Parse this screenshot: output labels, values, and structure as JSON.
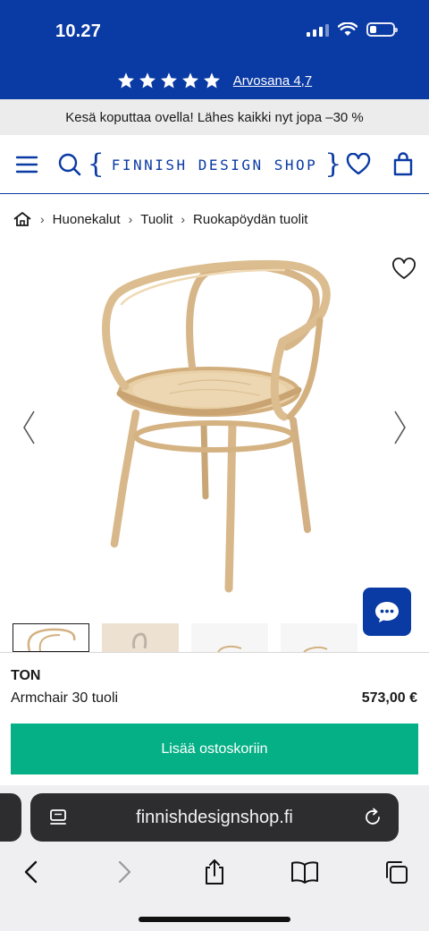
{
  "status_bar": {
    "time": "10.27",
    "battery_level": 0.3
  },
  "rating": {
    "stars": 5,
    "label": "Arvosana 4,7"
  },
  "promo": {
    "text": "Kesä koputtaa ovella! Lähes kaikki nyt jopa –30 %"
  },
  "header": {
    "logo_text": "FINNISH DESIGN SHOP",
    "icons": [
      "menu-icon",
      "search-icon",
      "heart-icon",
      "bag-icon"
    ],
    "accent_color": "#0a3aa3"
  },
  "breadcrumb": {
    "items": [
      {
        "label": "Huonekalut"
      },
      {
        "label": "Tuolit"
      },
      {
        "label": "Ruokapöydän tuolit"
      }
    ]
  },
  "product": {
    "brand": "TON",
    "name": "Armchair 30 tuoli",
    "price": "573,00 €",
    "add_to_cart_label": "Lisää ostoskoriin",
    "button_color": "#06b086",
    "thumbnail_count": 4
  },
  "browser": {
    "url": "finnishdesignshop.fi",
    "nav_icons": [
      "back-icon",
      "forward-icon",
      "share-icon",
      "bookmarks-icon",
      "tabs-icon"
    ]
  }
}
